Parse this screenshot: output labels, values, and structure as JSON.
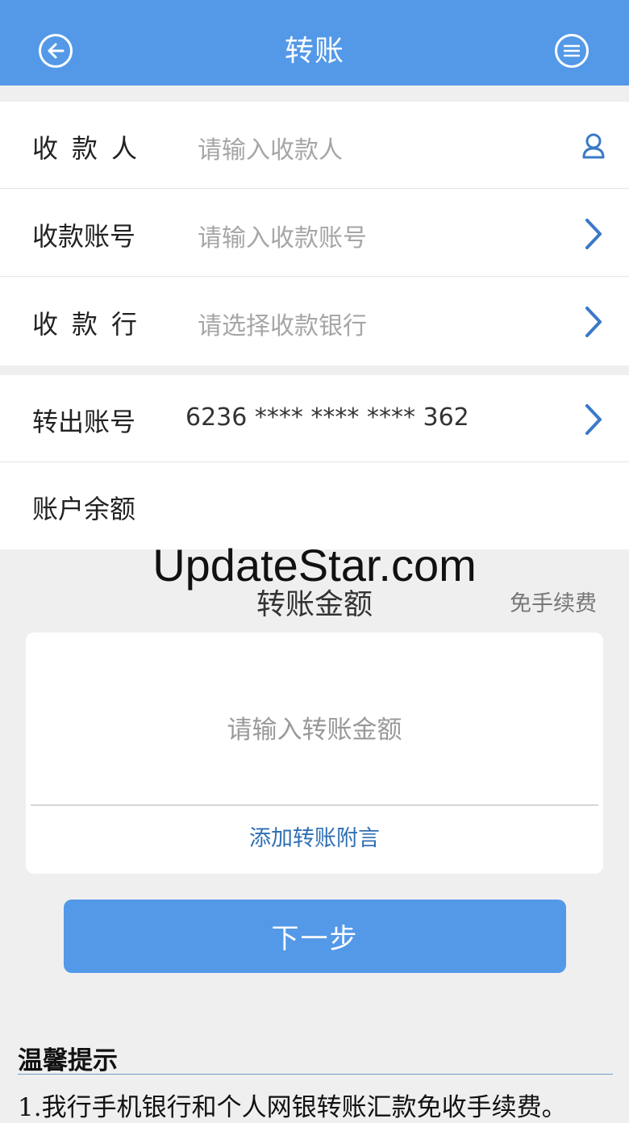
{
  "header": {
    "title": "转账",
    "back_icon": "back-arrow-icon",
    "menu_icon": "menu-icon",
    "bg_color": "#5499e8"
  },
  "payee_section": {
    "payee": {
      "label": "收款人",
      "placeholder": "请输入收款人",
      "icon": "contact-person-icon"
    },
    "account": {
      "label": "收款账号",
      "placeholder": "请输入收款账号",
      "icon": "chevron-right-icon"
    },
    "bank": {
      "label": "收款行",
      "placeholder": "请选择收款银行",
      "icon": "chevron-right-icon"
    }
  },
  "source_section": {
    "from_account": {
      "label": "转出账号",
      "value": "6236 **** **** **** 362",
      "icon": "chevron-right-icon"
    },
    "balance": {
      "label": "账户余额",
      "value": ""
    }
  },
  "watermark": "UpdateStar.com",
  "amount_section": {
    "title": "转账金额",
    "fee_note": "免手续费",
    "placeholder": "请输入转账金额",
    "memo_link": "添加转账附言"
  },
  "next_button": "下一步",
  "tips": {
    "title": "温馨提示",
    "items": [
      "1.我行手机银行和个人网银转账汇款免收手续费。"
    ]
  },
  "colors": {
    "accent": "#5499e8",
    "link": "#2f6fb4",
    "chevron": "#3a79c8"
  }
}
